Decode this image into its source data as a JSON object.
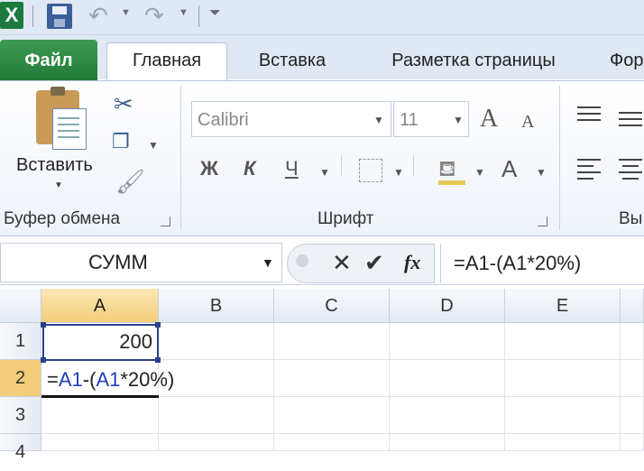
{
  "quick_access": {
    "app_icon": "X",
    "icons": [
      "excel-logo-icon",
      "save-icon",
      "undo-icon",
      "redo-icon",
      "customize-qat-icon"
    ]
  },
  "tabs": {
    "file": "Файл",
    "home": "Главная",
    "insert": "Вставка",
    "page_layout": "Разметка страницы",
    "formulas_partial": "Фор"
  },
  "ribbon": {
    "clipboard": {
      "paste_label": "Вставить",
      "group_label": "Буфер обмена"
    },
    "font": {
      "font_name": "Calibri",
      "font_size": "11",
      "grow_label": "A",
      "shrink_label": "A",
      "bold": "Ж",
      "italic": "К",
      "underline": "Ч",
      "color_a": "A",
      "group_label": "Шрифт"
    },
    "alignment": {
      "group_label_partial": "Вы"
    }
  },
  "formula_bar": {
    "name_box": "СУММ",
    "formula": "=A1-(A1*20%)",
    "cancel_symbol": "✕",
    "enter_symbol": "✔",
    "fx_symbol": "fx"
  },
  "grid": {
    "columns": [
      "A",
      "B",
      "C",
      "D",
      "E"
    ],
    "rows": [
      "1",
      "2",
      "3",
      "4"
    ],
    "a1_value": "200",
    "a2_formula_parts": {
      "eq": "=",
      "ref1": "A1",
      "mid": "-(",
      "ref2": "A1",
      "tail": "*20%)"
    }
  },
  "colors": {
    "file_tab": "#1f7a36",
    "selected_header": "#f3cd7a",
    "reference_blue": "#1f3fbf"
  }
}
